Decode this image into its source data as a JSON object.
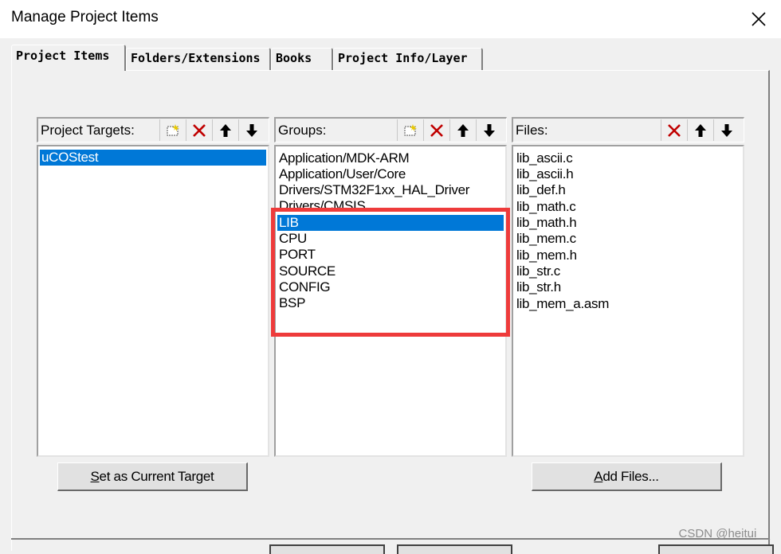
{
  "window": {
    "title": "Manage Project Items"
  },
  "tabs": [
    {
      "label": "Project Items",
      "active": true
    },
    {
      "label": "Folders/Extensions",
      "active": false
    },
    {
      "label": "Books",
      "active": false
    },
    {
      "label": "Project Info/Layer",
      "active": false
    }
  ],
  "targets": {
    "label": "Project Targets:",
    "items": [
      "uCOStest"
    ],
    "selected_index": 0
  },
  "groups": {
    "label": "Groups:",
    "items": [
      "Application/MDK-ARM",
      "Application/User/Core",
      "Drivers/STM32F1xx_HAL_Driver",
      "Drivers/CMSIS",
      "LIB",
      "CPU",
      "PORT",
      "SOURCE",
      "CONFIG",
      "BSP"
    ],
    "selected_index": 4
  },
  "files": {
    "label": "Files:",
    "items": [
      "lib_ascii.c",
      "lib_ascii.h",
      "lib_def.h",
      "lib_math.c",
      "lib_math.h",
      "lib_mem.c",
      "lib_mem.h",
      "lib_str.c",
      "lib_str.h",
      "lib_mem_a.asm"
    ]
  },
  "buttons": {
    "set_target_accel": "S",
    "set_target_rest": "et as Current Target",
    "add_files_accel": "A",
    "add_files_rest": "dd Files..."
  },
  "icons": {
    "new": "new-item-icon",
    "delete": "delete-icon",
    "up": "move-up-icon",
    "down": "move-down-icon",
    "close": "close-icon"
  },
  "colors": {
    "selection": "#0078d7",
    "highlight_box": "#ee3b3b",
    "delete_icon": "#c00000"
  },
  "watermark": "CSDN @heitui__"
}
